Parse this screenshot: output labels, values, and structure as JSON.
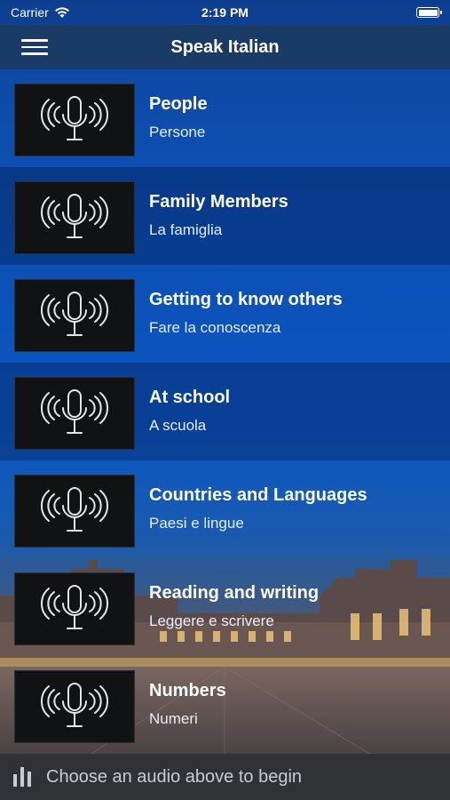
{
  "status_bar": {
    "carrier": "Carrier",
    "time": "2:19 PM",
    "wifi_icon": "wifi-icon",
    "battery_icon": "battery-icon"
  },
  "nav": {
    "title": "Speak Italian",
    "menu_icon": "hamburger-menu-icon"
  },
  "items": [
    {
      "title": "People",
      "subtitle": "Persone",
      "icon": "microphone-icon"
    },
    {
      "title": "Family Members",
      "subtitle": "La famiglia",
      "icon": "microphone-icon"
    },
    {
      "title": "Getting to know others",
      "subtitle": "Fare la conoscenza",
      "icon": "microphone-icon"
    },
    {
      "title": "At school",
      "subtitle": "A scuola",
      "icon": "microphone-icon"
    },
    {
      "title": "Countries and Languages",
      "subtitle": "Paesi e lingue",
      "icon": "microphone-icon"
    },
    {
      "title": "Reading and writing",
      "subtitle": "Leggere e scrivere",
      "icon": "microphone-icon"
    },
    {
      "title": "Numbers",
      "subtitle": "Numeri",
      "icon": "microphone-icon"
    }
  ],
  "player": {
    "message": "Choose an audio above to begin",
    "icon": "audio-bars-icon"
  },
  "colors": {
    "nav_bg": "#1a3b66",
    "bottom_bar_bg": "#303236",
    "thumb_bg": "#101214"
  }
}
